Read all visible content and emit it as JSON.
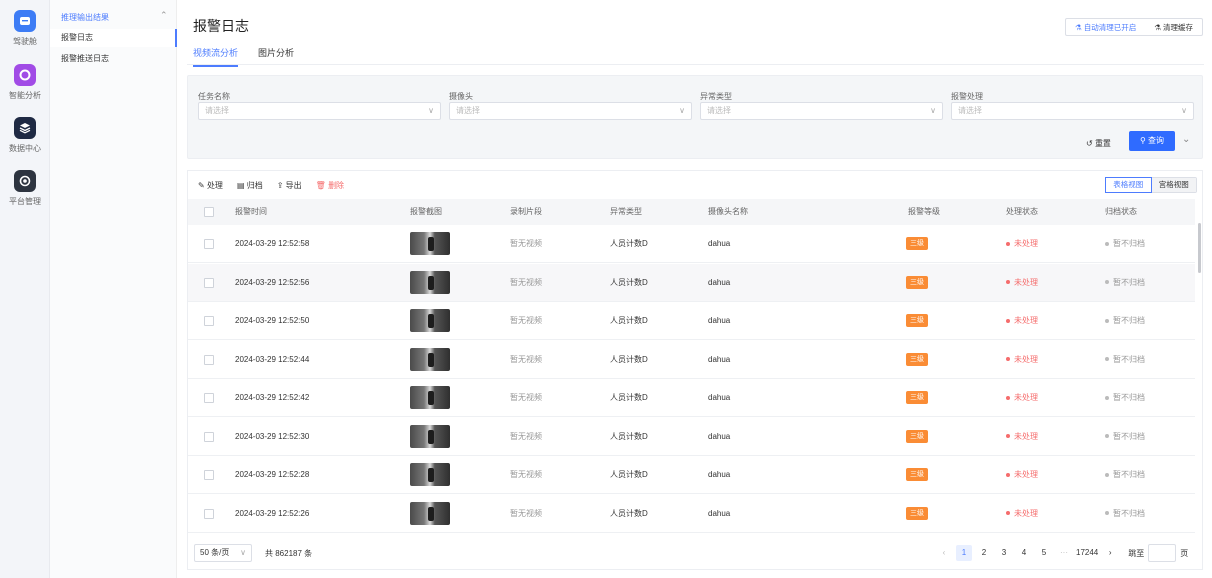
{
  "rail": {
    "items": [
      {
        "label": "驾驶舱",
        "icon": "dashboard-icon"
      },
      {
        "label": "智能分析",
        "icon": "analysis-icon"
      },
      {
        "label": "数据中心",
        "icon": "data-layers-icon"
      },
      {
        "label": "平台管理",
        "icon": "settings-icon"
      }
    ]
  },
  "submenu": {
    "group": "推理输出结果",
    "items": [
      {
        "label": "报警日志",
        "active": true
      },
      {
        "label": "报警推送日志",
        "active": false
      }
    ]
  },
  "header": {
    "title": "报警日志",
    "auto_clean": "自动清理已开启",
    "clean_cache": "清理缓存"
  },
  "tabs": [
    {
      "label": "视频流分析",
      "active": true
    },
    {
      "label": "图片分析",
      "active": false
    }
  ],
  "filters": {
    "fields": [
      {
        "label": "任务名称",
        "placeholder": "请选择"
      },
      {
        "label": "摄像头",
        "placeholder": "请选择"
      },
      {
        "label": "异常类型",
        "placeholder": "请选择"
      },
      {
        "label": "报警处理",
        "placeholder": "请选择"
      }
    ],
    "reset": "重置",
    "query": "查询"
  },
  "toolbar": {
    "process": "处理",
    "archive": "归档",
    "export": "导出",
    "delete": "删除",
    "table_view": "表格视图",
    "grid_view": "宫格视图"
  },
  "table": {
    "columns": [
      "报警时间",
      "报警截图",
      "录制片段",
      "异常类型",
      "摄像头名称",
      "报警等级",
      "处理状态",
      "归档状态"
    ],
    "rows": [
      {
        "time": "2024-03-29 12:52:58",
        "clip": "暂无视频",
        "type": "人员计数D",
        "camera": "dahua",
        "level": "三级",
        "status": "未处理",
        "archive": "暂不归档"
      },
      {
        "time": "2024-03-29 12:52:56",
        "clip": "暂无视频",
        "type": "人员计数D",
        "camera": "dahua",
        "level": "三级",
        "status": "未处理",
        "archive": "暂不归档"
      },
      {
        "time": "2024-03-29 12:52:50",
        "clip": "暂无视频",
        "type": "人员计数D",
        "camera": "dahua",
        "level": "三级",
        "status": "未处理",
        "archive": "暂不归档"
      },
      {
        "time": "2024-03-29 12:52:44",
        "clip": "暂无视频",
        "type": "人员计数D",
        "camera": "dahua",
        "level": "三级",
        "status": "未处理",
        "archive": "暂不归档"
      },
      {
        "time": "2024-03-29 12:52:42",
        "clip": "暂无视频",
        "type": "人员计数D",
        "camera": "dahua",
        "level": "三级",
        "status": "未处理",
        "archive": "暂不归档"
      },
      {
        "time": "2024-03-29 12:52:30",
        "clip": "暂无视频",
        "type": "人员计数D",
        "camera": "dahua",
        "level": "三级",
        "status": "未处理",
        "archive": "暂不归档"
      },
      {
        "time": "2024-03-29 12:52:28",
        "clip": "暂无视频",
        "type": "人员计数D",
        "camera": "dahua",
        "level": "三级",
        "status": "未处理",
        "archive": "暂不归档"
      },
      {
        "time": "2024-03-29 12:52:26",
        "clip": "暂无视频",
        "type": "人员计数D",
        "camera": "dahua",
        "level": "三级",
        "status": "未处理",
        "archive": "暂不归档"
      }
    ]
  },
  "pagination": {
    "page_size": "50 条/页",
    "total": "共 862187 条",
    "pages": [
      "1",
      "2",
      "3",
      "4",
      "5"
    ],
    "ellipsis": "···",
    "last_page": "17244",
    "goto_label": "跳至",
    "goto_unit": "页"
  },
  "colors": {
    "accent": "#2f6bff",
    "badge": "#fa8c35",
    "danger": "#f56c6c"
  }
}
